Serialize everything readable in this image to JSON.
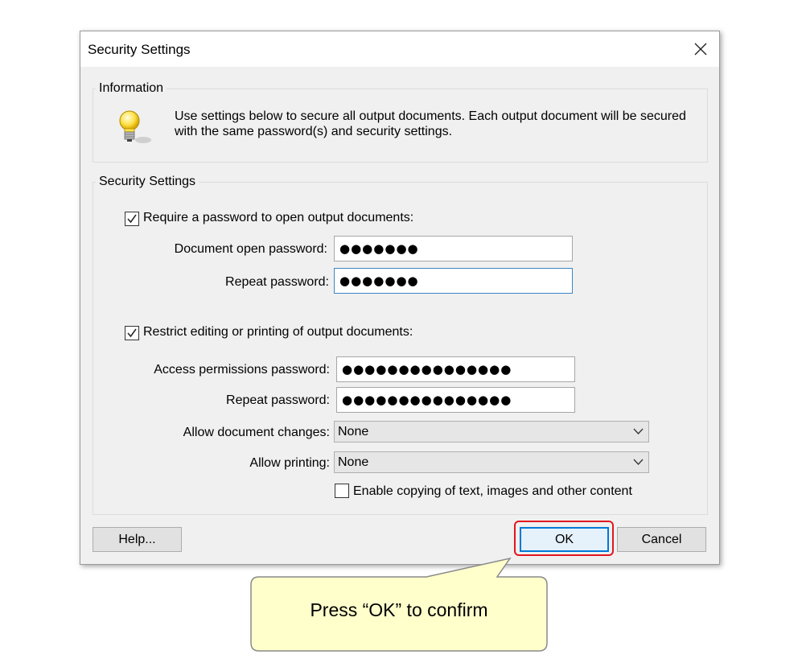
{
  "dialog": {
    "title": "Security Settings",
    "close_icon": "close-icon"
  },
  "information": {
    "legend": "Information",
    "icon": "lightbulb-icon",
    "text_line1": "Use settings below to secure all output documents. Each output document will be secured",
    "text_line2": "with the same password(s) and security settings."
  },
  "security": {
    "legend": "Security Settings",
    "require_open_password": {
      "checked": true,
      "label": "Require a password to open output documents:"
    },
    "open_password_label": "Document open password:",
    "open_password_value": "●●●●●●●",
    "repeat_open_label": "Repeat password:",
    "repeat_open_value": "●●●●●●●",
    "restrict_editing": {
      "checked": true,
      "label": "Restrict editing or printing of output documents:"
    },
    "permissions_password_label": "Access permissions password:",
    "permissions_password_value": "●●●●●●●●●●●●●●●",
    "repeat_permissions_label": "Repeat password:",
    "repeat_permissions_value": "●●●●●●●●●●●●●●●",
    "allow_changes_label": "Allow document changes:",
    "allow_changes_value": "None",
    "allow_printing_label": "Allow printing:",
    "allow_printing_value": "None",
    "enable_copying": {
      "checked": false,
      "label": "Enable copying of text, images and other content"
    }
  },
  "buttons": {
    "help": "Help...",
    "ok": "OK",
    "cancel": "Cancel"
  },
  "callout": {
    "text": "Press “OK” to confirm",
    "fill": "#ffffcc",
    "highlight_color": "#e1161f"
  }
}
